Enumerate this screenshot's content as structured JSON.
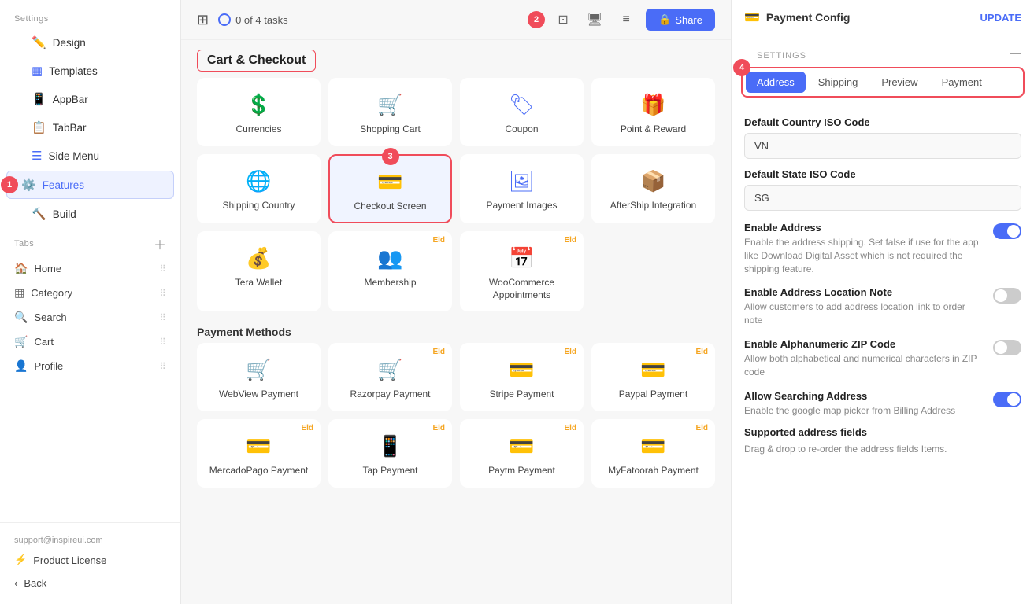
{
  "sidebar": {
    "settings_label": "Settings",
    "design_label": "Design",
    "templates_label": "Templates",
    "appbar_label": "AppBar",
    "tabbar_label": "TabBar",
    "side_menu_label": "Side Menu",
    "features_label": "Features",
    "build_label": "Build",
    "tabs_label": "Tabs",
    "tabs": [
      {
        "icon": "🏠",
        "label": "Home"
      },
      {
        "icon": "▦",
        "label": "Category"
      },
      {
        "icon": "🔍",
        "label": "Search"
      },
      {
        "icon": "🛒",
        "label": "Cart"
      },
      {
        "icon": "👤",
        "label": "Profile"
      }
    ],
    "email": "support@inspireui.com",
    "product_license_label": "Product License",
    "back_label": "Back",
    "step1_label": "1"
  },
  "topbar": {
    "tasks_label": "0 of 4 tasks",
    "share_label": "Share",
    "step2_label": "2"
  },
  "main": {
    "section_title": "Cart & Checkout",
    "step3_label": "3",
    "features": [
      {
        "icon": "💲",
        "label": "Currencies",
        "eld": false
      },
      {
        "icon": "🛒",
        "label": "Shopping Cart",
        "eld": false
      },
      {
        "icon": "🏷",
        "label": "Coupon",
        "eld": false
      },
      {
        "icon": "🎁",
        "label": "Point & Reward",
        "eld": false
      },
      {
        "icon": "🌐",
        "label": "Shipping Country",
        "eld": false
      },
      {
        "icon": "💳",
        "label": "Checkout Screen",
        "eld": false,
        "selected": true,
        "highlight": true
      },
      {
        "icon": "🖼",
        "label": "Payment Images",
        "eld": false
      },
      {
        "icon": "📦",
        "label": "AfterShip Integration",
        "eld": false
      },
      {
        "icon": "💰",
        "label": "Tera Wallet",
        "eld": false
      },
      {
        "icon": "👥",
        "label": "Membership",
        "eld": true
      },
      {
        "icon": "📅",
        "label": "WooCommerce Appointments",
        "eld": true
      }
    ],
    "payment_methods_label": "Payment Methods",
    "payment_methods": [
      {
        "icon": "🛒",
        "label": "WebView Payment",
        "eld": false
      },
      {
        "icon": "🛒",
        "label": "Razorpay Payment",
        "eld": true
      },
      {
        "icon": "💳",
        "label": "Stripe Payment",
        "eld": true
      },
      {
        "icon": "💳",
        "label": "Paypal Payment",
        "eld": true
      },
      {
        "icon": "💳",
        "label": "MercadoPago Payment",
        "eld": true
      },
      {
        "icon": "📱",
        "label": "Tap Payment",
        "eld": true
      },
      {
        "icon": "💳",
        "label": "Paytm Payment",
        "eld": true
      },
      {
        "icon": "💳",
        "label": "MyFatoorah Payment",
        "eld": true
      }
    ]
  },
  "right_panel": {
    "title": "Payment Config",
    "update_label": "UPDATE",
    "settings_label": "SETTINGS",
    "step4_label": "4",
    "tabs": [
      {
        "label": "Address",
        "active": true
      },
      {
        "label": "Shipping",
        "active": false
      },
      {
        "label": "Preview",
        "active": false
      },
      {
        "label": "Payment",
        "active": false
      }
    ],
    "country_code_label": "Default Country ISO Code",
    "country_code_value": "VN",
    "state_code_label": "Default State ISO Code",
    "state_code_value": "SG",
    "toggles": [
      {
        "title": "Enable Address",
        "desc": "Enable the address shipping. Set false if use for the app like Download Digital Asset which is not required the shipping feature.",
        "on": true
      },
      {
        "title": "Enable Address Location Note",
        "desc": "Allow customers to add address location link to order note",
        "on": false
      },
      {
        "title": "Enable Alphanumeric ZIP Code",
        "desc": "Allow both alphabetical and numerical characters in ZIP code",
        "on": false
      },
      {
        "title": "Allow Searching Address",
        "desc": "Enable the google map picker from Billing Address",
        "on": true
      }
    ],
    "supported_label": "Supported address fields",
    "supported_desc": "Drag & drop to re-order the address fields Items."
  }
}
